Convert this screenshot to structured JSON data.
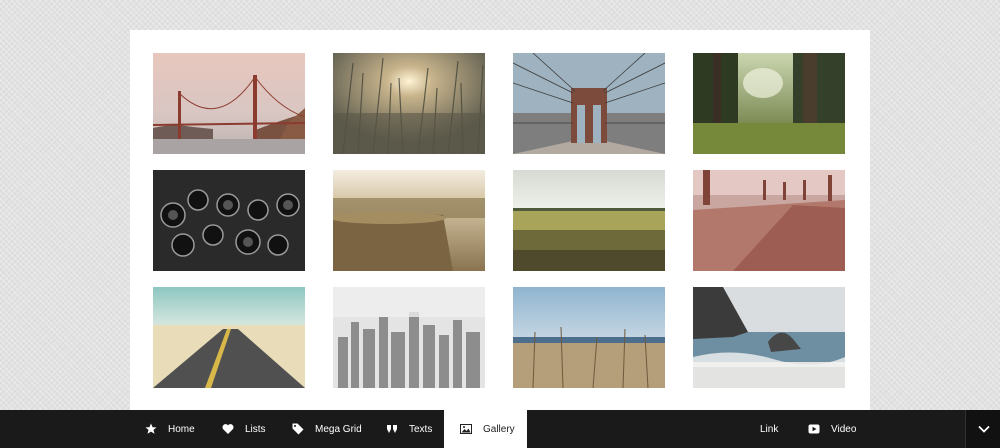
{
  "gallery": {
    "items": [
      {
        "name": "golden-gate-bridge-photo"
      },
      {
        "name": "tall-grass-sunset-photo"
      },
      {
        "name": "brooklyn-bridge-photo"
      },
      {
        "name": "forest-clearing-photo"
      },
      {
        "name": "vintage-cameras-photo"
      },
      {
        "name": "tree-stump-photo"
      },
      {
        "name": "wheat-field-photo"
      },
      {
        "name": "autumn-path-photo"
      },
      {
        "name": "desert-road-photo"
      },
      {
        "name": "city-skyline-photo"
      },
      {
        "name": "beach-grass-photo"
      },
      {
        "name": "ocean-rocks-photo"
      }
    ]
  },
  "menu": {
    "home": "Home",
    "lists": "Lists",
    "mega_grid": "Mega Grid",
    "texts": "Texts",
    "gallery": "Gallery",
    "link": "Link",
    "video": "Video"
  },
  "icons": {
    "home": "star-icon",
    "lists": "heart-icon",
    "mega_grid": "tag-icon",
    "texts": "quote-icon",
    "gallery": "image-icon",
    "video": "play-icon",
    "toggle": "chevron-down-icon"
  },
  "colors": {
    "menubar_bg": "#1a1a1a",
    "active_bg": "#ffffff",
    "page_bg": "#e2e2e2"
  }
}
